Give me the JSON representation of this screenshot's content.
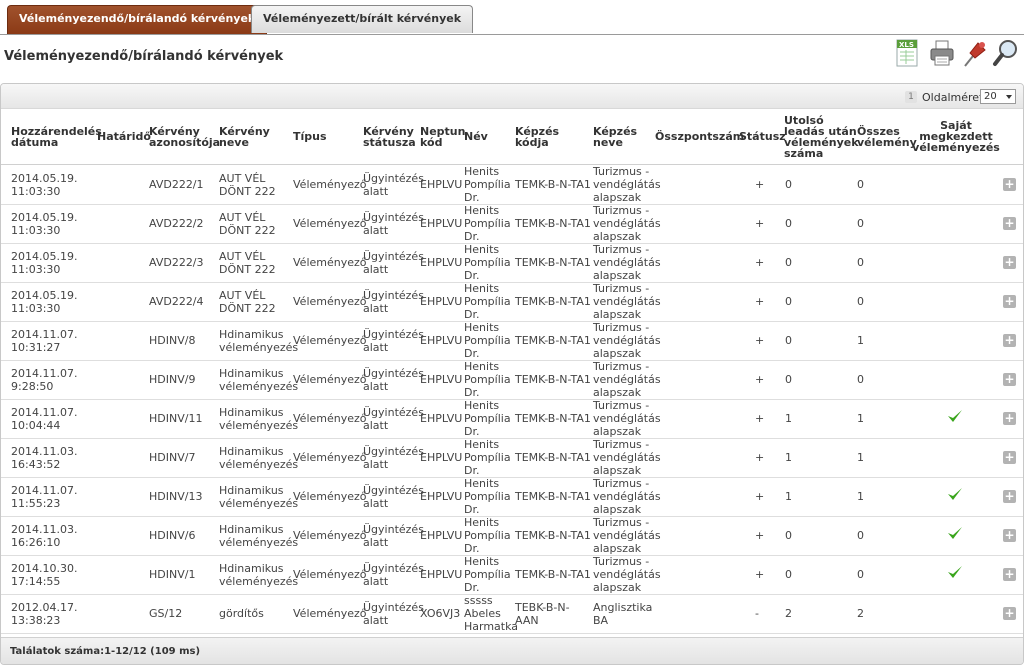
{
  "tabs": [
    {
      "label": "Véleményezendő/bírálandó kérvények"
    },
    {
      "label": "Véleményezett/bírált kérvények"
    }
  ],
  "page_title": "Véleményezendő/bírálandó kérvények",
  "toolbar": {
    "icons": [
      "xls-export-icon",
      "print-icon",
      "pin-icon",
      "search-icon"
    ]
  },
  "pager": {
    "current_page": "1",
    "page_size_label": "Oldalméret",
    "page_size_value": "20"
  },
  "columns": {
    "assign_date": "Hozzárendelés dátuma",
    "deadline": "Határidő",
    "request_id": "Kérvény azonosítója",
    "request_name": "Kérvény neve",
    "type": "Típus",
    "request_status": "Kérvény státusza",
    "neptun": "Neptun kód",
    "name": "Név",
    "program_code": "Képzés kódja",
    "program_name": "Képzés neve",
    "score": "Összpontszám",
    "status": "Státusz",
    "reviews_after_last": "Utolsó leadás után vélemények száma",
    "total_reviews": "Összes vélemény",
    "own_started": "Saját megkezdett véleményezés"
  },
  "rows": [
    {
      "date": "2014.05.19.",
      "time": "11:03:30",
      "id": "AVD222/1",
      "name1": "AUT VÉL",
      "name2": "DÖNT 222",
      "type": "Véleményező",
      "st1": "Ügyintézés",
      "st2": "alatt",
      "neptun": "EHPLVU",
      "n1": "Henits",
      "n2": "Pompília",
      "n3": "Dr.",
      "code": "TEMK-B-N-TA1",
      "p1": "Turizmus -",
      "p2": "vendéglátás",
      "p3": "alapszak",
      "status": "+",
      "after": "0",
      "total": "0",
      "check": false
    },
    {
      "date": "2014.05.19.",
      "time": "11:03:30",
      "id": "AVD222/2",
      "name1": "AUT VÉL",
      "name2": "DÖNT 222",
      "type": "Véleményező",
      "st1": "Ügyintézés",
      "st2": "alatt",
      "neptun": "EHPLVU",
      "n1": "Henits",
      "n2": "Pompília",
      "n3": "Dr.",
      "code": "TEMK-B-N-TA1",
      "p1": "Turizmus -",
      "p2": "vendéglátás",
      "p3": "alapszak",
      "status": "+",
      "after": "0",
      "total": "0",
      "check": false
    },
    {
      "date": "2014.05.19.",
      "time": "11:03:30",
      "id": "AVD222/3",
      "name1": "AUT VÉL",
      "name2": "DÖNT 222",
      "type": "Véleményező",
      "st1": "Ügyintézés",
      "st2": "alatt",
      "neptun": "EHPLVU",
      "n1": "Henits",
      "n2": "Pompília",
      "n3": "Dr.",
      "code": "TEMK-B-N-TA1",
      "p1": "Turizmus -",
      "p2": "vendéglátás",
      "p3": "alapszak",
      "status": "+",
      "after": "0",
      "total": "0",
      "check": false
    },
    {
      "date": "2014.05.19.",
      "time": "11:03:30",
      "id": "AVD222/4",
      "name1": "AUT VÉL",
      "name2": "DÖNT 222",
      "type": "Véleményező",
      "st1": "Ügyintézés",
      "st2": "alatt",
      "neptun": "EHPLVU",
      "n1": "Henits",
      "n2": "Pompília",
      "n3": "Dr.",
      "code": "TEMK-B-N-TA1",
      "p1": "Turizmus -",
      "p2": "vendéglátás",
      "p3": "alapszak",
      "status": "+",
      "after": "0",
      "total": "0",
      "check": false
    },
    {
      "date": "2014.11.07.",
      "time": "10:31:27",
      "id": "HDINV/8",
      "name1": "Hdinamikus",
      "name2": "véleményezés",
      "type": "Véleményező",
      "st1": "Ügyintézés",
      "st2": "alatt",
      "neptun": "EHPLVU",
      "n1": "Henits",
      "n2": "Pompília",
      "n3": "Dr.",
      "code": "TEMK-B-N-TA1",
      "p1": "Turizmus -",
      "p2": "vendéglátás",
      "p3": "alapszak",
      "status": "+",
      "after": "0",
      "total": "1",
      "check": false
    },
    {
      "date": "2014.11.07.",
      "time": "9:28:50",
      "id": "HDINV/9",
      "name1": "Hdinamikus",
      "name2": "véleményezés",
      "type": "Véleményező",
      "st1": "Ügyintézés",
      "st2": "alatt",
      "neptun": "EHPLVU",
      "n1": "Henits",
      "n2": "Pompília",
      "n3": "Dr.",
      "code": "TEMK-B-N-TA1",
      "p1": "Turizmus -",
      "p2": "vendéglátás",
      "p3": "alapszak",
      "status": "+",
      "after": "0",
      "total": "0",
      "check": false
    },
    {
      "date": "2014.11.07.",
      "time": "10:04:44",
      "id": "HDINV/11",
      "name1": "Hdinamikus",
      "name2": "véleményezés",
      "type": "Véleményező",
      "st1": "Ügyintézés",
      "st2": "alatt",
      "neptun": "EHPLVU",
      "n1": "Henits",
      "n2": "Pompília",
      "n3": "Dr.",
      "code": "TEMK-B-N-TA1",
      "p1": "Turizmus -",
      "p2": "vendéglátás",
      "p3": "alapszak",
      "status": "+",
      "after": "1",
      "total": "1",
      "check": true
    },
    {
      "date": "2014.11.03.",
      "time": "16:43:52",
      "id": "HDINV/7",
      "name1": "Hdinamikus",
      "name2": "véleményezés",
      "type": "Véleményező",
      "st1": "Ügyintézés",
      "st2": "alatt",
      "neptun": "EHPLVU",
      "n1": "Henits",
      "n2": "Pompília",
      "n3": "Dr.",
      "code": "TEMK-B-N-TA1",
      "p1": "Turizmus -",
      "p2": "vendéglátás",
      "p3": "alapszak",
      "status": "+",
      "after": "1",
      "total": "1",
      "check": false
    },
    {
      "date": "2014.11.07.",
      "time": "11:55:23",
      "id": "HDINV/13",
      "name1": "Hdinamikus",
      "name2": "véleményezés",
      "type": "Véleményező",
      "st1": "Ügyintézés",
      "st2": "alatt",
      "neptun": "EHPLVU",
      "n1": "Henits",
      "n2": "Pompília",
      "n3": "Dr.",
      "code": "TEMK-B-N-TA1",
      "p1": "Turizmus -",
      "p2": "vendéglátás",
      "p3": "alapszak",
      "status": "+",
      "after": "1",
      "total": "1",
      "check": true
    },
    {
      "date": "2014.11.03.",
      "time": "16:26:10",
      "id": "HDINV/6",
      "name1": "Hdinamikus",
      "name2": "véleményezés",
      "type": "Véleményező",
      "st1": "Ügyintézés",
      "st2": "alatt",
      "neptun": "EHPLVU",
      "n1": "Henits",
      "n2": "Pompília",
      "n3": "Dr.",
      "code": "TEMK-B-N-TA1",
      "p1": "Turizmus -",
      "p2": "vendéglátás",
      "p3": "alapszak",
      "status": "+",
      "after": "0",
      "total": "0",
      "check": true
    },
    {
      "date": "2014.10.30.",
      "time": "17:14:55",
      "id": "HDINV/1",
      "name1": "Hdinamikus",
      "name2": "véleményezés",
      "type": "Véleményező",
      "st1": "Ügyintézés",
      "st2": "alatt",
      "neptun": "EHPLVU",
      "n1": "Henits",
      "n2": "Pompília",
      "n3": "Dr.",
      "code": "TEMK-B-N-TA1",
      "p1": "Turizmus -",
      "p2": "vendéglátás",
      "p3": "alapszak",
      "status": "+",
      "after": "0",
      "total": "0",
      "check": true
    },
    {
      "date": "2012.04.17.",
      "time": "13:38:23",
      "id": "GS/12",
      "name1": "gördítős",
      "name2": "",
      "type": "Véleményező",
      "st1": "Ügyintézés",
      "st2": "alatt",
      "neptun": "XO6VJ3",
      "n1": "sssss",
      "n2": "Abeles",
      "n3": "Harmatka",
      "code": "TEBK-B-N-AAN",
      "p1": "Anglisztika",
      "p2": "BA",
      "p3": "",
      "status": "-",
      "after": "2",
      "total": "2",
      "check": false
    }
  ],
  "footer": "Találatok száma:1-12/12 (109 ms)",
  "colors": {
    "tab_active": "#8b3a16",
    "check": "#3aa51c",
    "plus_button": "#b3b3b3"
  }
}
